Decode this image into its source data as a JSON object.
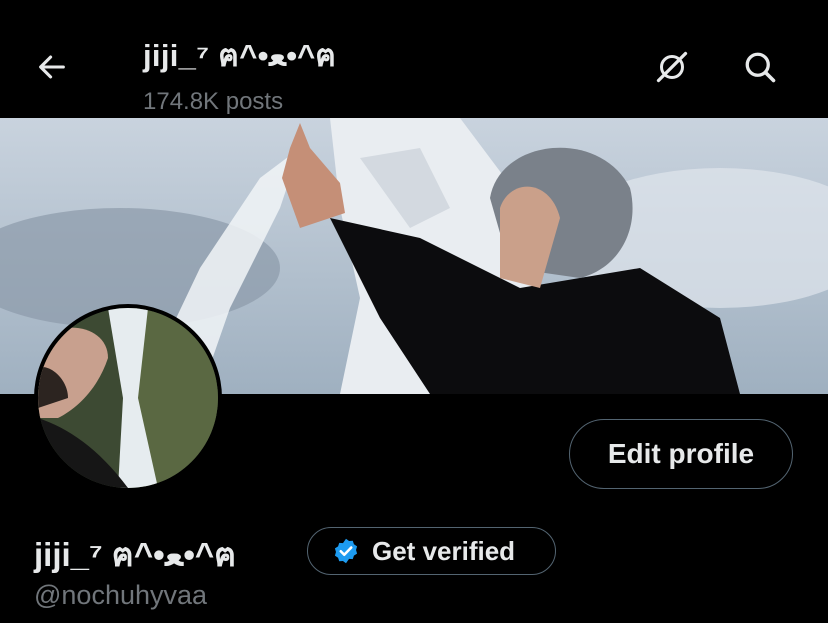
{
  "header": {
    "title": "jiji_⁷ ฅ^•ﻌ•^ฅ",
    "posts": "174.8K posts"
  },
  "profile": {
    "display_name": "jiji_⁷ ฅ^•ﻌ•^ฅ",
    "handle": "@nochuhyvaa",
    "edit_label": "Edit profile",
    "verify_label": "Get verified"
  },
  "icons": {
    "back": "arrow-left-icon",
    "orbit": "grok-orbit-icon",
    "search": "search-icon",
    "verified": "verified-badge-icon"
  },
  "colors": {
    "background": "#000000",
    "text": "#e7e9ea",
    "muted": "#71767b",
    "border": "#536471",
    "verified_blue": "#1d9bf0"
  }
}
